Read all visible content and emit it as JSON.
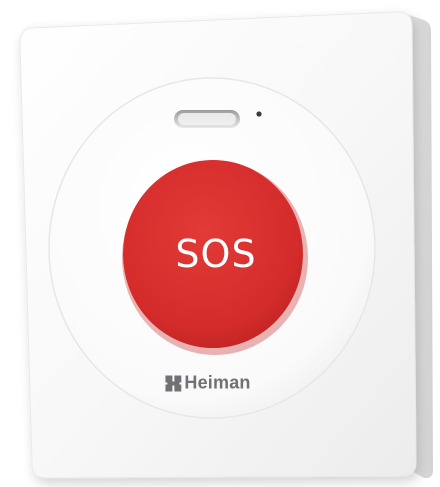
{
  "device": {
    "button_label": "SOS",
    "brand_name": "Heiman"
  },
  "colors": {
    "background": "#ffffff",
    "panel": "#f6f6f6",
    "panel_edge": "#e6e6e6",
    "button_red": "#d8302f",
    "brand_gray": "#6f7175"
  },
  "icons": {
    "indicator_light": "indicator-light-icon",
    "brand_logo": "heiman-logo-icon"
  }
}
